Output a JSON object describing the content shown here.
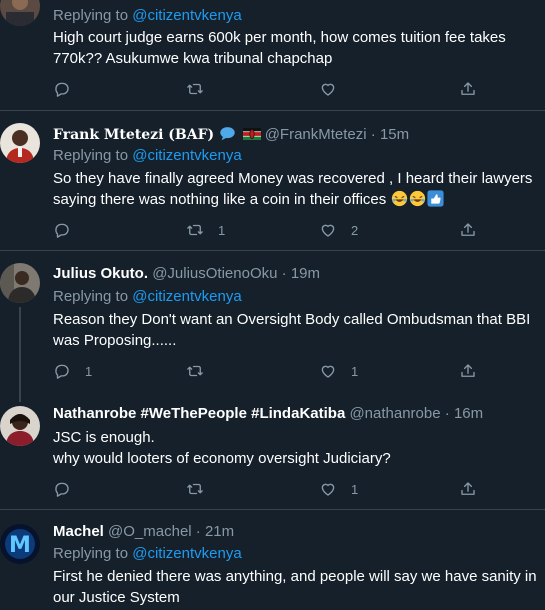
{
  "tweets": [
    {
      "reply_prefix": "Replying to ",
      "reply_to": "@citizentvkenya",
      "body": [
        "High court judge earns 600k per month, how comes tuition fee takes",
        "770k?? Asukumwe kwa tribunal chapchap"
      ],
      "replies": "",
      "retweets": "",
      "likes": ""
    },
    {
      "name": "Frank Mtetezi (BAF)",
      "name_emoji": [
        "speech-bubble-icon",
        "kenya-flag-icon"
      ],
      "handle": "@FrankMtetezi",
      "sep": "·",
      "time": "15m",
      "reply_prefix": "Replying to ",
      "reply_to": "@citizentvkenya",
      "body": [
        "So they have finally agreed Money was recovered , I heard their lawyers",
        "saying there was nothing like a coin in their offices"
      ],
      "body_emoji": [
        "laughing-tears-icon",
        "laughing-tears-icon",
        "thumbs-up-icon"
      ],
      "replies": "",
      "retweets": "1",
      "likes": "2"
    },
    {
      "name": "Julius Okuto.",
      "handle": "@JuliusOtienoOku",
      "sep": "·",
      "time": "19m",
      "reply_prefix": "Replying to ",
      "reply_to": "@citizentvkenya",
      "body": [
        "Reason they Don't want an Oversight Body called Ombudsman that BBI",
        "was Proposing......"
      ],
      "replies": "1",
      "retweets": "",
      "likes": "1"
    },
    {
      "name": "Nathanrobe #WeThePeople #LindaKatiba",
      "handle": "@nathanrobe",
      "sep": "·",
      "time": "16m",
      "body": [
        "JSC is enough.",
        "why would looters of economy oversight Judiciary?"
      ],
      "replies": "",
      "retweets": "",
      "likes": "1"
    },
    {
      "name": "Machel",
      "handle": "@O_machel",
      "sep": "·",
      "time": "21m",
      "reply_prefix": "Replying to ",
      "reply_to": "@citizentvkenya",
      "body": [
        "First he denied there was anything, and people will say we have sanity in",
        "our Justice System"
      ]
    }
  ],
  "colors": {
    "background": "#15202b",
    "muted": "#8899a6",
    "accent": "#1d9bf0",
    "border": "#38444d"
  }
}
